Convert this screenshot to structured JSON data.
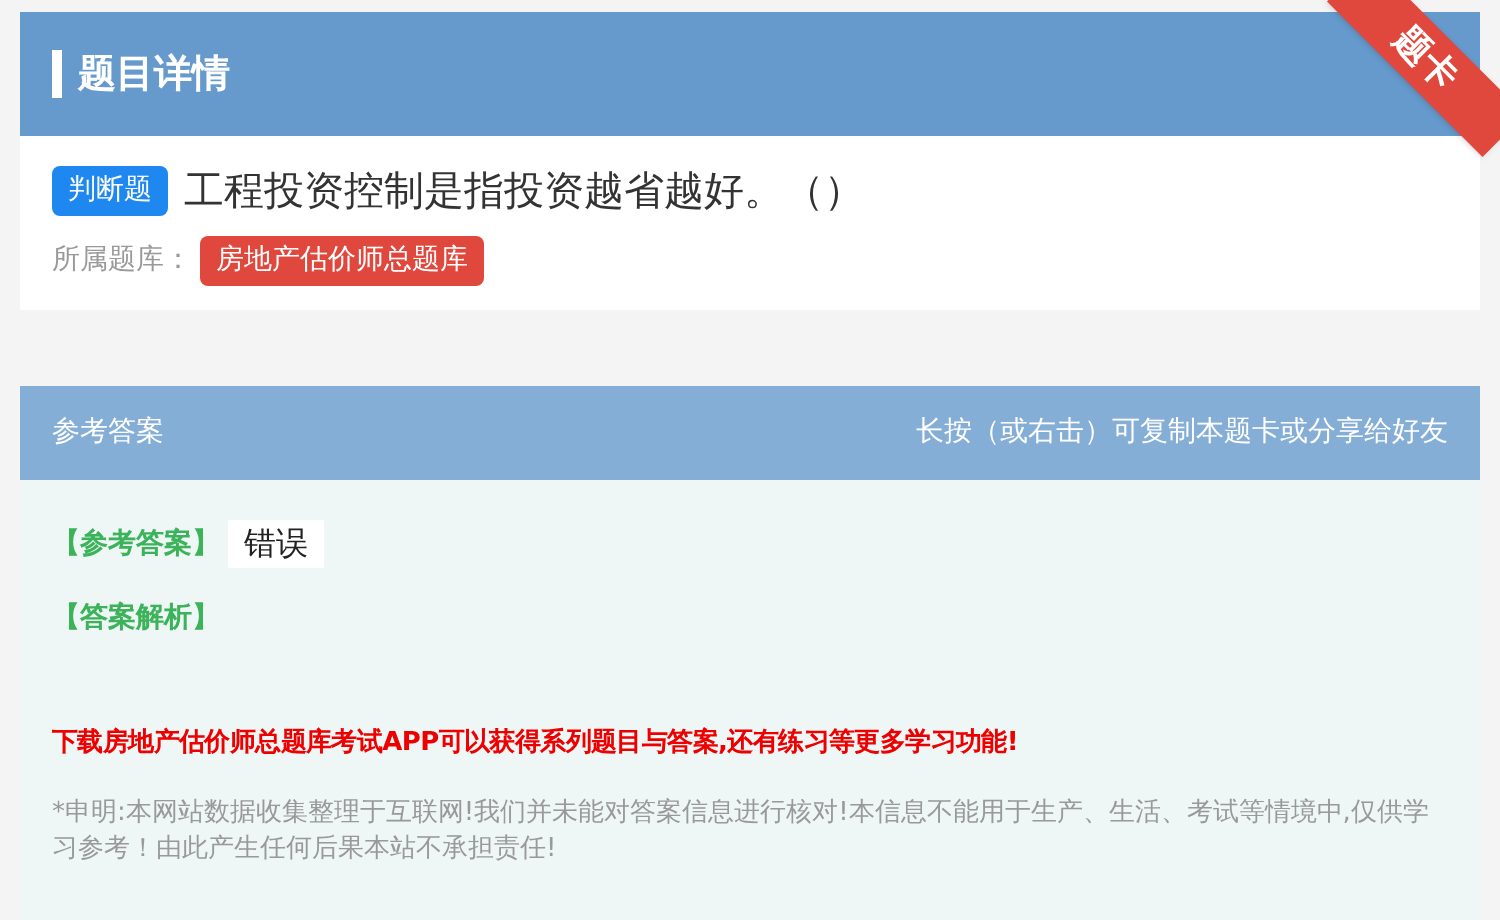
{
  "header": {
    "title": "题目详情",
    "ribbon": "题卡"
  },
  "question": {
    "type_badge": "判断题",
    "text": "工程投资控制是指投资越省越好。（）",
    "bank_label": "所属题库：",
    "bank": "房地产估价师总题库"
  },
  "answer_panel": {
    "title": "参考答案",
    "hint": "长按（或右击）可复制本题卡或分享给好友",
    "answer_label": "【参考答案】",
    "answer": "错误",
    "analysis_label": "【答案解析】",
    "promo": "下载房地产估价师总题库考试APP可以获得系列题目与答案,还有练习等更多学习功能!",
    "disclaimer": "*申明:本网站数据收集整理于互联网!我们并未能对答案信息进行核对!本信息不能用于生产、生活、考试等情境中,仅供学习参考！由此产生任何后果本站不承担责任!"
  }
}
